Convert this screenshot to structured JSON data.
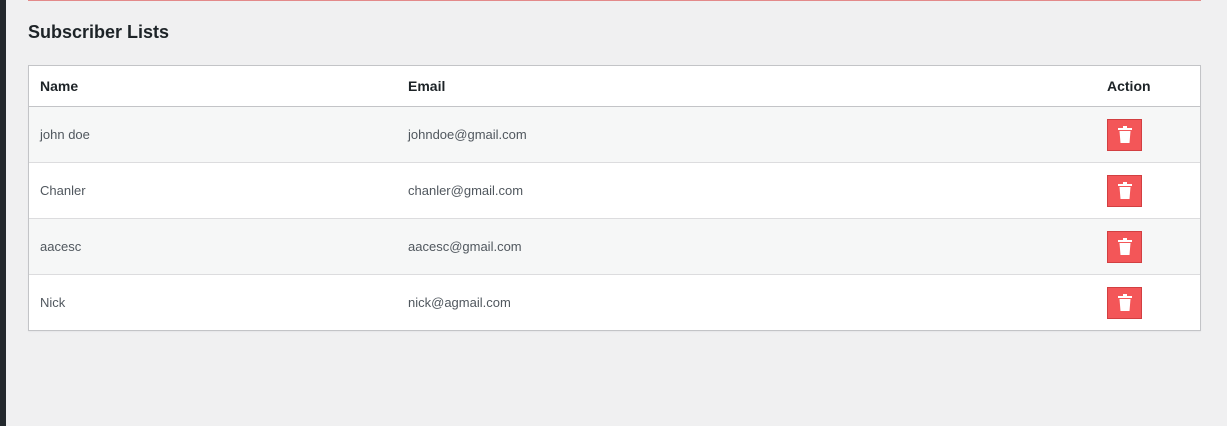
{
  "page": {
    "title": "Subscriber Lists"
  },
  "table": {
    "headers": {
      "name": "Name",
      "email": "Email",
      "action": "Action"
    },
    "rows": [
      {
        "name": "john doe",
        "email": "johndoe@gmail.com"
      },
      {
        "name": "Chanler",
        "email": "chanler@gmail.com"
      },
      {
        "name": "aacesc",
        "email": "aacesc@gmail.com"
      },
      {
        "name": "Nick",
        "email": "nick@agmail.com"
      }
    ],
    "action_icon": "trash-icon"
  },
  "colors": {
    "background": "#f0f0f1",
    "delete_button": "#f35658",
    "accent_rule": "#e38a8a"
  }
}
